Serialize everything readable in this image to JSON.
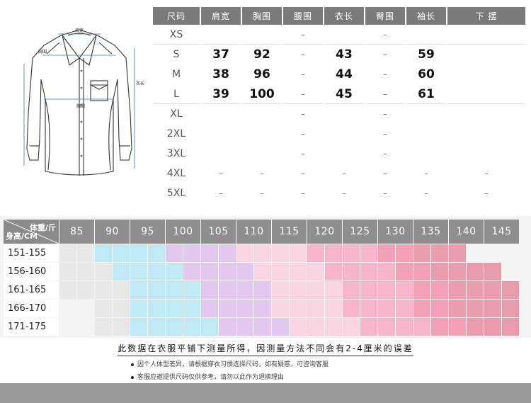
{
  "diagram": {
    "labels": {
      "shoulder": "肩宽",
      "chest": "胸围",
      "length": "衣长",
      "bust": "胸围",
      "sleeve": "袖长"
    }
  },
  "size_table": {
    "headers": [
      "尺码",
      "肩宽",
      "胸围",
      "腰围",
      "衣长",
      "臀围",
      "袖长",
      "下 摆"
    ],
    "rows": [
      [
        "XS",
        "",
        "",
        "–",
        "",
        "–",
        "",
        ""
      ],
      [
        "S",
        "37",
        "92",
        "–",
        "43",
        "–",
        "59",
        ""
      ],
      [
        "M",
        "38",
        "96",
        "–",
        "44",
        "–",
        "60",
        ""
      ],
      [
        "L",
        "39",
        "100",
        "–",
        "45",
        "–",
        "61",
        ""
      ],
      [
        "XL",
        "",
        "",
        "–",
        "",
        "–",
        "",
        ""
      ],
      [
        "2XL",
        "",
        "",
        "–",
        "",
        "–",
        "",
        ""
      ],
      [
        "3XL",
        "",
        "",
        "–",
        "",
        "–",
        "",
        ""
      ],
      [
        "4XL",
        "–",
        "–",
        "–",
        "–",
        "–",
        "–",
        "–"
      ],
      [
        "5XL",
        "–",
        "–",
        "–",
        "–",
        "–",
        "–",
        "–"
      ]
    ]
  },
  "weight_grid": {
    "weight_label": "体重/斤",
    "height_label": "身高/CM",
    "weights": [
      "85",
      "90",
      "95",
      "100",
      "105",
      "110",
      "115",
      "120",
      "125",
      "130",
      "135",
      "140",
      "145"
    ],
    "heights": [
      "151-155",
      "156-160",
      "161-165",
      "166-170",
      "171-175"
    ],
    "colors": [
      "#ffffff",
      "#e8e8e8",
      "#bfe9f5",
      "#e2c8ee",
      "#f9d4e1",
      "#f7b4ca",
      "#f49fb8",
      "#eb9cad",
      "#e99aab"
    ],
    "cells": [
      [
        1,
        1,
        2,
        2,
        2,
        2,
        3,
        3,
        3,
        3,
        4,
        4,
        4,
        4,
        5,
        5,
        5,
        5,
        6,
        6,
        7,
        7,
        7,
        0,
        0,
        0
      ],
      [
        1,
        1,
        1,
        2,
        2,
        2,
        2,
        3,
        3,
        3,
        3,
        4,
        4,
        4,
        4,
        5,
        5,
        5,
        5,
        6,
        6,
        7,
        7,
        8,
        8,
        0
      ],
      [
        1,
        1,
        1,
        1,
        2,
        2,
        2,
        2,
        3,
        3,
        3,
        3,
        4,
        4,
        4,
        4,
        5,
        5,
        5,
        5,
        6,
        6,
        7,
        7,
        8,
        8
      ],
      [
        0,
        0,
        1,
        1,
        2,
        2,
        2,
        2,
        3,
        3,
        3,
        3,
        4,
        4,
        4,
        4,
        5,
        5,
        5,
        5,
        6,
        6,
        7,
        7,
        8,
        8
      ],
      [
        0,
        0,
        1,
        1,
        2,
        2,
        2,
        2,
        2,
        3,
        3,
        3,
        3,
        4,
        4,
        4,
        4,
        5,
        5,
        5,
        5,
        6,
        6,
        7,
        8,
        8
      ]
    ]
  },
  "notes": {
    "main": "此数据在衣服平铺下测量所得，因测量方法不同会有2-4厘米的误差",
    "line1": "因个人体型差异，请根据穿衣习惯选择尺码，如有疑惑，可咨询客服",
    "line2": "客服应邀提供尺码仅供参考，请勿以此作为退换理由"
  }
}
